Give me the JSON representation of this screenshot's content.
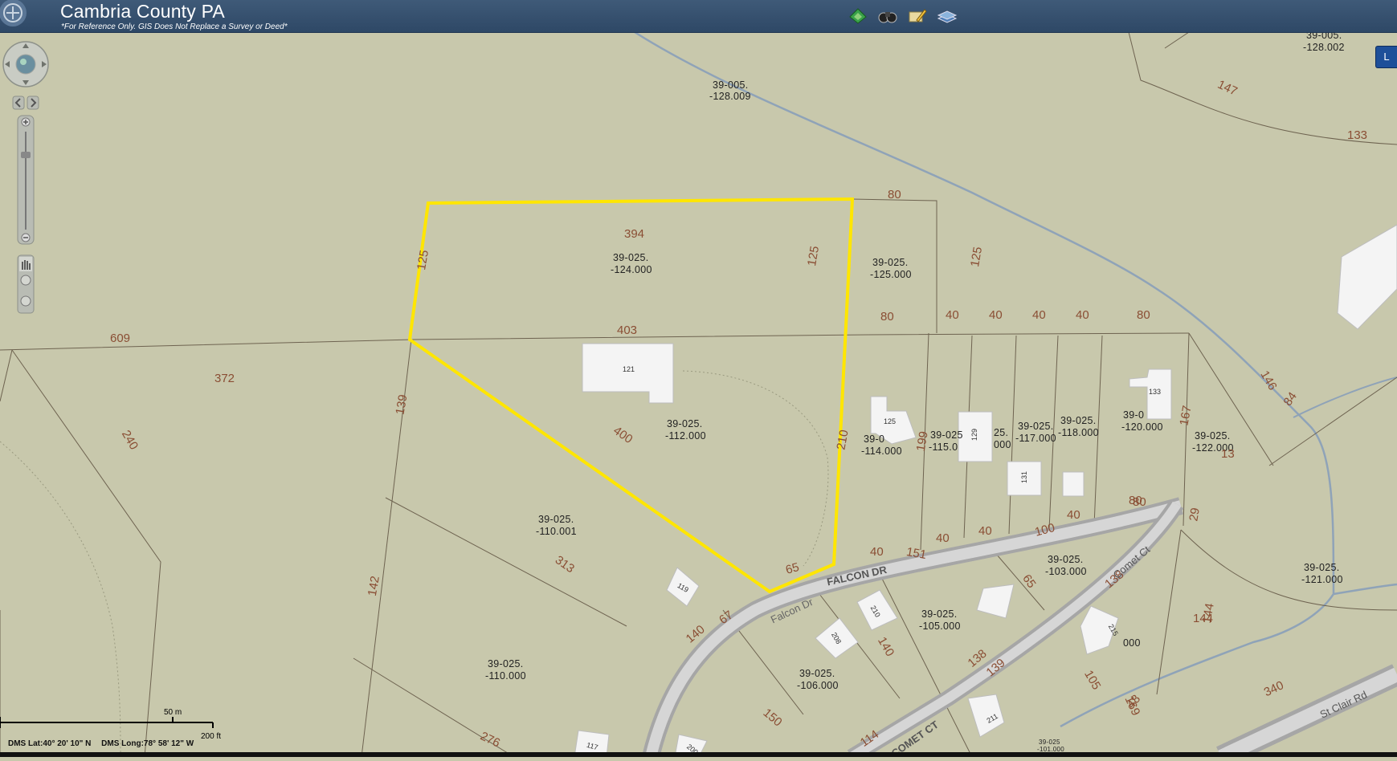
{
  "header": {
    "title": "Cambria County PA",
    "subtitle": "*For Reference Only. GIS Does Not Replace a Survey or Deed*",
    "side_button_label": "L"
  },
  "toolbar": {
    "icons": [
      "layers-icon",
      "binoculars-icon",
      "draw-pencil-icon",
      "basemap-icon"
    ]
  },
  "status": {
    "lat": "DMS Lat:40° 20' 10\" N",
    "long": "DMS Long:78° 58' 12\" W"
  },
  "scale": {
    "metric": "50 m",
    "imperial": "200 ft"
  },
  "colors": {
    "header": "#2e4866",
    "map_bg": "#c8c8ac",
    "selection": "#ffe600",
    "stream": "#8fa3b8",
    "parcel_line": "#6e6350",
    "dimension_text": "#8a4e34"
  },
  "map": {
    "parcel_ids": [
      {
        "line1": "39-005.",
        "line2": "-128.009"
      },
      {
        "line1": "39-005.",
        "line2": "-128.002"
      },
      {
        "line1": "39-025.",
        "line2": "-124.000"
      },
      {
        "line1": "39-025.",
        "line2": "-125.000"
      },
      {
        "line1": "39-025.",
        "line2": "-112.000"
      },
      {
        "line1": "39-025.",
        "line2": "-110.001"
      },
      {
        "line1": "39-025.",
        "line2": "-110.000"
      },
      {
        "line1": "39-0",
        "line2": "-114.000"
      },
      {
        "line1": "39-025",
        "line2": "-115.0"
      },
      {
        "line1": "25.",
        "line2": "000"
      },
      {
        "line1": "39-025.",
        "line2": "-117.000"
      },
      {
        "line1": "39-025.",
        "line2": "-118.000"
      },
      {
        "line1": "39-0",
        "line2": "-120.000"
      },
      {
        "line1": "39-025.",
        "line2": "-122.000"
      },
      {
        "line1": "39-025.",
        "line2": "-103.000"
      },
      {
        "line1": "39-025.",
        "line2": "-105.000"
      },
      {
        "line1": "39-025.",
        "line2": "-106.000"
      },
      {
        "line1": "39-025.",
        "line2": "-121.000"
      },
      {
        "line1": "39-025",
        "line2": "-101.000"
      }
    ],
    "dimensions": [
      "147",
      "133",
      "80",
      "394",
      "125",
      "125",
      "125",
      "609",
      "403",
      "80",
      "40",
      "40",
      "40",
      "40",
      "80",
      "372",
      "240",
      "139",
      "400",
      "210",
      "199",
      "167",
      "146",
      "84",
      "313",
      "142",
      "65",
      "40",
      "40",
      "40",
      "100",
      "40",
      "80",
      "29",
      "151",
      "144",
      "138",
      "65",
      "67",
      "140",
      "138",
      "140",
      "139",
      "105",
      "169",
      "48",
      "150",
      "114",
      "276",
      "340",
      "144",
      "13",
      "80"
    ],
    "building_numbers": [
      "121",
      "125",
      "129",
      "131",
      "133",
      "119",
      "210",
      "208",
      "215",
      "211",
      "117",
      "200"
    ],
    "roads": [
      "FALCON DR",
      "Falcon Dr",
      "COMET CT",
      "Comet Ct",
      "St Clair Rd"
    ],
    "partial_label": "000"
  }
}
